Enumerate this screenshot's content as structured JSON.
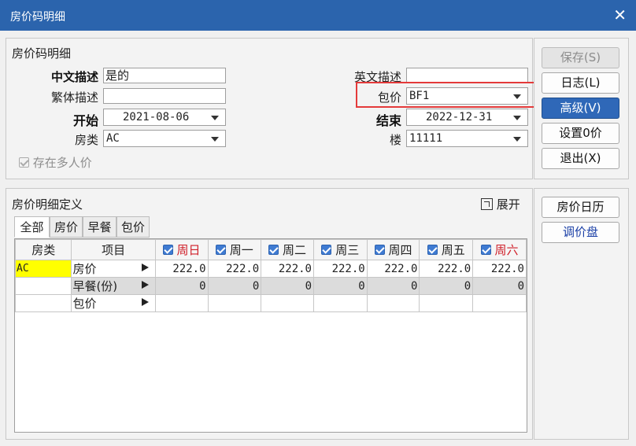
{
  "window": {
    "title": "房价码明细",
    "close_glyph": "✕"
  },
  "header_section": {
    "title": "房价码明细",
    "cn_desc_label": "中文描述",
    "cn_desc_value": "是的",
    "en_desc_label": "英文描述",
    "en_desc_value": "",
    "trad_desc_label": "繁体描述",
    "trad_desc_value": "",
    "package_label": "包价",
    "package_value": "BF1",
    "start_label": "开始",
    "start_value": "2021-08-06",
    "end_label": "结束",
    "end_value": "2022-12-31",
    "room_type_label": "房类",
    "room_type_value": "AC",
    "building_label": "楼",
    "building_value": "11111",
    "multi_price_label": "存在多人价"
  },
  "side_buttons": {
    "save": "保存(S)",
    "log": "日志(L)",
    "advanced": "高级(V)",
    "set_zero": "设置0价",
    "exit": "退出(X)",
    "price_calendar": "房价日历",
    "adjust_panel": "调价盘"
  },
  "detail_section": {
    "title": "房价明细定义",
    "expand_label": "展开",
    "tabs": [
      "全部",
      "房价",
      "早餐",
      "包价"
    ],
    "columns": {
      "room_type": "房类",
      "item": "项目",
      "days": [
        "周日",
        "周一",
        "周二",
        "周三",
        "周四",
        "周五",
        "周六"
      ]
    },
    "rows": [
      {
        "room_type": "AC",
        "item": "房价",
        "values": [
          "222.0",
          "222.0",
          "222.0",
          "222.0",
          "222.0",
          "222.0",
          "222.0"
        ]
      },
      {
        "room_type": "",
        "item": "早餐(份)",
        "values": [
          "0",
          "0",
          "0",
          "0",
          "0",
          "0",
          "0"
        ]
      },
      {
        "room_type": "",
        "item": "包价",
        "values": [
          "",
          "",
          "",
          "",
          "",
          "",
          ""
        ]
      }
    ]
  },
  "colors": {
    "titlebar": "#2b64ad",
    "primary_button": "#2f68b8",
    "highlight_yellow": "#ffff00",
    "weekend_red": "#d0202a",
    "callout_red": "#e43a3a"
  }
}
